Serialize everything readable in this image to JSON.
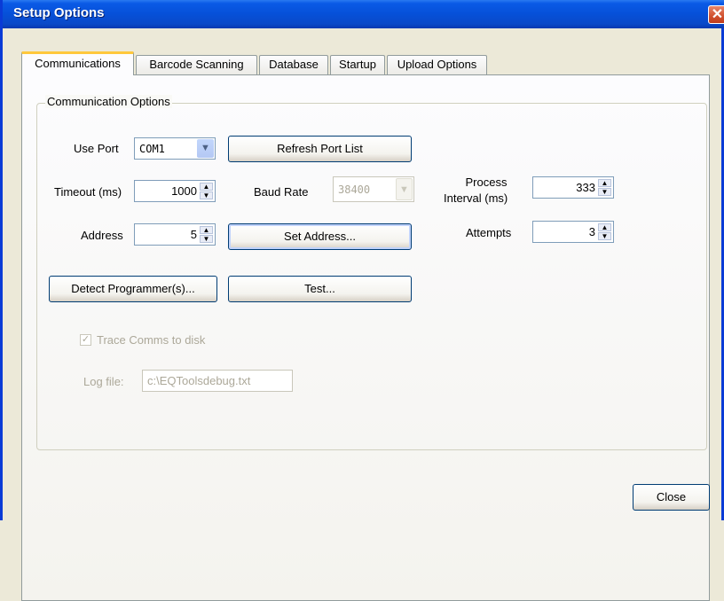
{
  "window": {
    "title": "Setup Options",
    "close_glyph": "✕"
  },
  "tabs": [
    {
      "label": "Communications",
      "active": true
    },
    {
      "label": "Barcode Scanning"
    },
    {
      "label": "Database"
    },
    {
      "label": "Startup"
    },
    {
      "label": "Upload Options"
    }
  ],
  "group": {
    "label": "Communication Options"
  },
  "fields": {
    "use_port": {
      "label": "Use Port",
      "value": "COM1"
    },
    "timeout": {
      "label": "Timeout (ms)",
      "value": "1000"
    },
    "baud_rate": {
      "label": "Baud Rate",
      "value": "38400"
    },
    "address": {
      "label": "Address",
      "value": "5"
    },
    "process_interval": {
      "label_line1": "Process",
      "label_line2": "Interval (ms)",
      "value": "333"
    },
    "attempts": {
      "label": "Attempts",
      "value": "3"
    }
  },
  "buttons": {
    "refresh": "Refresh Port List",
    "set_address": "Set Address...",
    "detect": "Detect Programmer(s)...",
    "test": "Test...",
    "close": "Close"
  },
  "trace": {
    "label": "Trace Comms to disk",
    "checked": true,
    "check_glyph": "✓"
  },
  "log": {
    "label": "Log file:",
    "value": "c:\\EQToolsdebug.txt"
  },
  "icons": {
    "spin_up": "▲",
    "spin_down": "▼",
    "dropdown": "▼"
  },
  "colors": {
    "title_bar": "#0a5ae6",
    "active_tab_accent": "#ffc83c",
    "close_button": "#d0502e"
  }
}
